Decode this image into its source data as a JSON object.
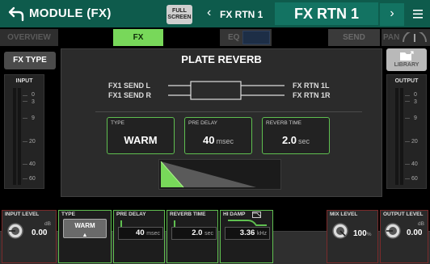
{
  "header": {
    "title": "MODULE (FX)",
    "fullscreen_line1": "FULL",
    "fullscreen_line2": "SCREEN",
    "prev_channel": "FX RTN 1",
    "current_channel": "FX RTN 1"
  },
  "tabs": {
    "overview": "OVERVIEW",
    "fx": "FX",
    "eq": "EQ",
    "send": "SEND",
    "pan": "PAN"
  },
  "left": {
    "fx_type": "FX TYPE",
    "input_label": "INPUT",
    "scale": [
      "0",
      "3",
      "9",
      "20",
      "40",
      "60"
    ]
  },
  "right": {
    "library": "LIBRARY",
    "output_label": "OUTPUT",
    "scale": [
      "0",
      "3",
      "9",
      "20",
      "40",
      "60"
    ]
  },
  "effect": {
    "name": "PLATE REVERB",
    "send_l": "FX1 SEND L",
    "send_r": "FX1 SEND R",
    "rtn_l": "FX RTN 1L",
    "rtn_r": "FX RTN 1R",
    "params": {
      "type": {
        "caption": "TYPE",
        "value": "WARM",
        "unit": ""
      },
      "pre_delay": {
        "caption": "PRE DELAY",
        "value": "40",
        "unit": "msec"
      },
      "reverb_time": {
        "caption": "REVERB TIME",
        "value": "2.0",
        "unit": "sec"
      }
    }
  },
  "bottom": {
    "input_level": {
      "caption": "INPUT LEVEL",
      "db": "dB",
      "value": "0.00"
    },
    "type": {
      "caption": "TYPE",
      "value": "WARM"
    },
    "pre_delay": {
      "caption": "PRE DELAY",
      "value": "40",
      "unit": "msec"
    },
    "reverb_time": {
      "caption": "REVERB TIME",
      "value": "2.0",
      "unit": "sec"
    },
    "hi_damp": {
      "caption": "HI DAMP",
      "value": "3.36",
      "unit": "kHz"
    },
    "mix_level": {
      "caption": "MIX LEVEL",
      "value": "100",
      "unit": "%"
    },
    "output_level": {
      "caption": "OUTPUT LEVEL",
      "db": "dB",
      "value": "0.00"
    }
  },
  "colors": {
    "header_bg": "#0e5b4c",
    "accent_green": "#78d85a",
    "param_border": "#5fbf50",
    "knob_border": "#7a2a2a"
  }
}
